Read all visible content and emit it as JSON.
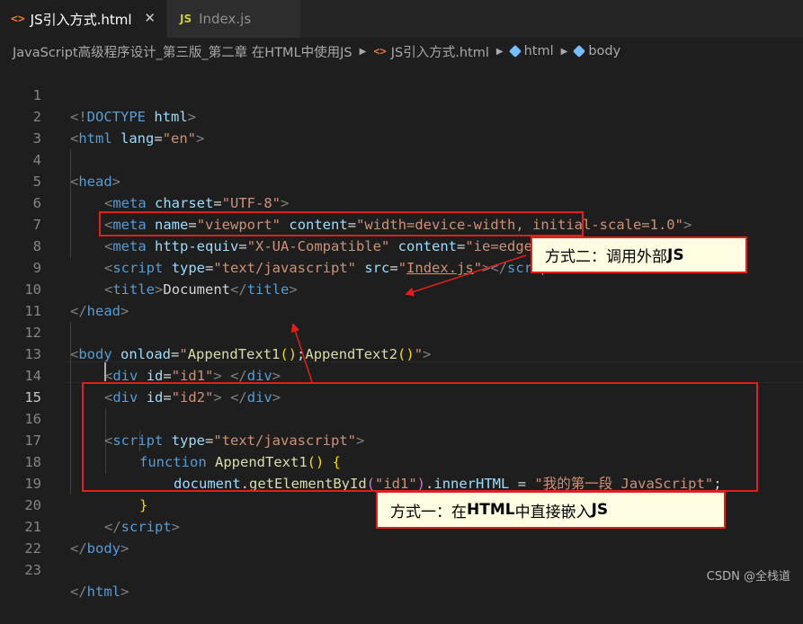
{
  "tabs": [
    {
      "icon": "<>",
      "label": "JS引入方式.html",
      "close": "✕"
    },
    {
      "icon": "JS",
      "label": "Index.js"
    }
  ],
  "breadcrumb": {
    "folder": "JavaScript高级程序设计_第三版_第二章 在HTML中使用JS",
    "file_icon": "<>",
    "file": "JS引入方式.html",
    "node1": "html",
    "node2": "body"
  },
  "line_numbers": [
    "1",
    "2",
    "3",
    "4",
    "5",
    "6",
    "7",
    "8",
    "9",
    "10",
    "11",
    "12",
    "13",
    "14",
    "15",
    "16",
    "17",
    "18",
    "19",
    "20",
    "21",
    "22",
    "23"
  ],
  "code": {
    "l1": {
      "open": "<!",
      "tag": "DOCTYPE",
      "sp": " ",
      "attr": "html",
      "close": ">"
    },
    "l2": {
      "open": "<",
      "tag": "html",
      "sp": " ",
      "attr": "lang",
      "eq": "=",
      "val": "\"en\"",
      "close": ">"
    },
    "l4": {
      "open": "<",
      "tag": "head",
      "close": ">"
    },
    "l5": {
      "open": "<",
      "tag": "meta",
      "sp": " ",
      "attr": "charset",
      "eq": "=",
      "val": "\"UTF-8\"",
      "close": ">"
    },
    "l6": {
      "open": "<",
      "tag": "meta",
      "sp": " ",
      "a1": "name",
      "eq1": "=",
      "v1": "\"viewport\"",
      "sp2": " ",
      "a2": "content",
      "eq2": "=",
      "v2": "\"width=device-width, initial-scale=1.0\"",
      "close": ">"
    },
    "l7": {
      "open": "<",
      "tag": "meta",
      "sp": " ",
      "a1": "http-equiv",
      "eq1": "=",
      "v1": "\"X-UA-Compatible\"",
      "sp2": " ",
      "a2": "content",
      "eq2": "=",
      "v2": "\"ie=edge\"",
      "close": ">"
    },
    "l8": {
      "open": "<",
      "tag": "script",
      "sp": " ",
      "a1": "type",
      "eq1": "=",
      "v1": "\"text/javascript\"",
      "sp2": " ",
      "a2": "src",
      "eq2": "=",
      "q1": "\"",
      "v2": "Index.js",
      "q2": "\"",
      "close": "></",
      "tag2": "script",
      "close2": ">"
    },
    "l9": {
      "open": "<",
      "tag": "title",
      "close": ">",
      "text": "Document",
      "open2": "</",
      "tag2": "title",
      "close2": ">"
    },
    "l10": {
      "open": "</",
      "tag": "head",
      "close": ">"
    },
    "l12": {
      "open": "<",
      "tag": "body",
      "sp": " ",
      "attr": "onload",
      "eq": "=",
      "q1": "\"",
      "f1": "AppendText1",
      "p1": "()",
      "semi": ";",
      "f2": "AppendText2",
      "p2": "()",
      "q2": "\"",
      "close": ">"
    },
    "l13": {
      "open": "<",
      "tag": "div",
      "sp": " ",
      "attr": "id",
      "eq": "=",
      "val": "\"id1\"",
      "close": ">",
      "sp2": " ",
      "open2": "</",
      "tag2": "div",
      "close2": ">"
    },
    "l14": {
      "open": "<",
      "tag": "div",
      "sp": " ",
      "attr": "id",
      "eq": "=",
      "val": "\"id2\"",
      "close": ">",
      "sp2": " ",
      "open2": "</",
      "tag2": "div",
      "close2": ">"
    },
    "l16": {
      "open": "<",
      "tag": "script",
      "sp": " ",
      "attr": "type",
      "eq": "=",
      "val": "\"text/javascript\"",
      "close": ">"
    },
    "l17": {
      "kw": "function",
      "sp": " ",
      "fn": "AppendText1",
      "paren": "()",
      "sp2": " ",
      "brace": "{"
    },
    "l18": {
      "obj": "document",
      "dot1": ".",
      "method": "getElementById",
      "po": "(",
      "arg": "\"id1\"",
      "pc": ")",
      "dot2": ".",
      "prop": "innerHTML",
      "eq": " = ",
      "str": "\"我的第一段 JavaScript\"",
      "semi": ";"
    },
    "l19": {
      "brace": "}"
    },
    "l20": {
      "open": "</",
      "tag": "script",
      "close": ">"
    },
    "l21": {
      "open": "</",
      "tag": "body",
      "close": ">"
    },
    "l23": {
      "open": "</",
      "tag": "html",
      "close": ">"
    }
  },
  "annotations": {
    "method2_prefix": "方式二：调用外部",
    "method2_bold": "JS",
    "method1_prefix": "方式一：在",
    "method1_bold1": "HTML",
    "method1_mid": "中直接嵌入",
    "method1_bold2": "JS"
  },
  "watermark": "CSDN @全栈道",
  "colors": {
    "background": "#1e1e1e",
    "tag": "#569cd6",
    "attribute": "#9cdcfe",
    "string": "#ce9178",
    "function": "#dcdcaa",
    "annotation_border": "#e0201f",
    "annotation_fill": "#fffde2"
  }
}
